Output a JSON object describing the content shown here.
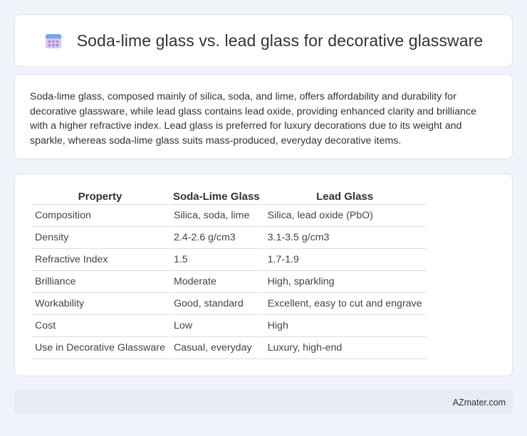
{
  "header": {
    "icon": "calendar-icon",
    "title": "Soda-lime glass vs. lead glass for decorative glassware"
  },
  "intro": {
    "text": "Soda-lime glass, composed mainly of silica, soda, and lime, offers affordability and durability for decorative glassware, while lead glass contains lead oxide, providing enhanced clarity and brilliance with a higher refractive index. Lead glass is preferred for luxury decorations due to its weight and sparkle, whereas soda-lime glass suits mass-produced, everyday decorative items."
  },
  "table": {
    "headers": [
      "Property",
      "Soda-Lime Glass",
      "Lead Glass"
    ],
    "rows": [
      [
        "Composition",
        "Silica, soda, lime",
        "Silica, lead oxide (PbO)"
      ],
      [
        "Density",
        "2.4-2.6 g/cm3",
        "3.1-3.5 g/cm3"
      ],
      [
        "Refractive Index",
        "1.5",
        "1.7-1.9"
      ],
      [
        "Brilliance",
        "Moderate",
        "High, sparkling"
      ],
      [
        "Workability",
        "Good, standard",
        "Excellent, easy to cut and engrave"
      ],
      [
        "Cost",
        "Low",
        "High"
      ],
      [
        "Use in Decorative Glassware",
        "Casual, everyday",
        "Luxury, high-end"
      ]
    ]
  },
  "footer": {
    "brand": "AZmater.com"
  },
  "colors": {
    "background": "#f0f3f9",
    "footer_bg": "#e6ebf5",
    "icon_accent": "#6aa9e9",
    "icon_body": "#c9a8e6"
  }
}
